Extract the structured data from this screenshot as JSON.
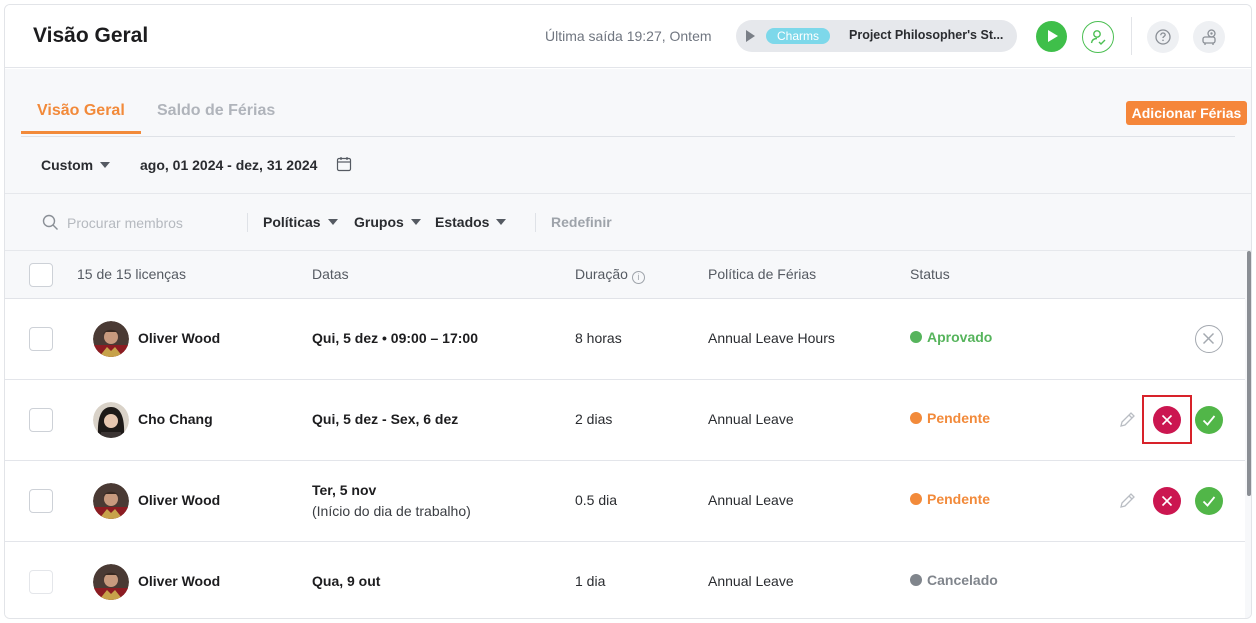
{
  "header": {
    "title": "Visão Geral",
    "last_exit": "Última saída 19:27, Ontem",
    "timer": {
      "project_tag": "Charms",
      "project_name": "Project Philosopher's St..."
    }
  },
  "tabs": [
    {
      "label": "Visão Geral",
      "active": true
    },
    {
      "label": "Saldo de Férias",
      "active": false
    }
  ],
  "add_button_label": "Adicionar Férias",
  "date_filter": {
    "mode": "Custom",
    "range": "ago, 01 2024 - dez, 31 2024"
  },
  "filters": {
    "search_placeholder": "Procurar membros",
    "policies": "Políticas",
    "groups": "Grupos",
    "states": "Estados",
    "reset": "Redefinir"
  },
  "table": {
    "columns": {
      "count": "15 de 15 licenças",
      "dates": "Datas",
      "duration": "Duração",
      "policy": "Política de Férias",
      "status": "Status"
    },
    "rows": [
      {
        "name": "Oliver Wood",
        "dates": "Qui, 5 dez • 09:00 – 17:00",
        "dates_sub": "",
        "duration": "8 horas",
        "policy": "Annual Leave Hours",
        "status": "Aprovado"
      },
      {
        "name": "Cho Chang",
        "dates": "Qui, 5 dez - Sex, 6 dez",
        "dates_sub": "",
        "duration": "2 dias",
        "policy": "Annual Leave",
        "status": "Pendente"
      },
      {
        "name": "Oliver Wood",
        "dates": "Ter, 5 nov",
        "dates_sub": "(Início do dia de trabalho)",
        "duration": "0.5 dia",
        "policy": "Annual Leave",
        "status": "Pendente"
      },
      {
        "name": "Oliver Wood",
        "dates": "Qua, 9 out",
        "dates_sub": "",
        "duration": "1 dia",
        "policy": "Annual Leave",
        "status": "Cancelado"
      }
    ]
  },
  "colors": {
    "accent": "#f28a3a",
    "approved": "#56b45c",
    "reject": "#cb1650",
    "cancelled": "#80858c"
  }
}
